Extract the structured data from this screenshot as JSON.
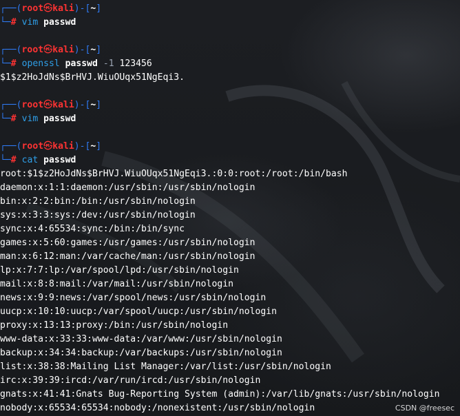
{
  "prompt": {
    "open": "┌──(",
    "user": "root",
    "skull": "㉿",
    "host": "kali",
    "mid": ")-[",
    "dir": "~",
    "close": "]",
    "lower": "└─",
    "hash": "#"
  },
  "commands": [
    {
      "cmd": "vim",
      "args": [
        "passwd"
      ]
    },
    {
      "cmd": "openssl",
      "args": [
        "passwd"
      ],
      "opt": "-1",
      "num": "123456"
    },
    {
      "cmd": "vim",
      "args": [
        "passwd"
      ]
    },
    {
      "cmd": "cat",
      "args": [
        "passwd"
      ]
    }
  ],
  "openssl_output": "$1$z2HoJdNs$BrHVJ.WiuOUqx51NgEqi3.",
  "passwd_lines": [
    "root:$1$z2HoJdNs$BrHVJ.WiuOUqx51NgEqi3.:0:0:root:/root:/bin/bash",
    "daemon:x:1:1:daemon:/usr/sbin:/usr/sbin/nologin",
    "bin:x:2:2:bin:/bin:/usr/sbin/nologin",
    "sys:x:3:3:sys:/dev:/usr/sbin/nologin",
    "sync:x:4:65534:sync:/bin:/bin/sync",
    "games:x:5:60:games:/usr/games:/usr/sbin/nologin",
    "man:x:6:12:man:/var/cache/man:/usr/sbin/nologin",
    "lp:x:7:7:lp:/var/spool/lpd:/usr/sbin/nologin",
    "mail:x:8:8:mail:/var/mail:/usr/sbin/nologin",
    "news:x:9:9:news:/var/spool/news:/usr/sbin/nologin",
    "uucp:x:10:10:uucp:/var/spool/uucp:/usr/sbin/nologin",
    "proxy:x:13:13:proxy:/bin:/usr/sbin/nologin",
    "www-data:x:33:33:www-data:/var/www:/usr/sbin/nologin",
    "backup:x:34:34:backup:/var/backups:/usr/sbin/nologin",
    "list:x:38:38:Mailing List Manager:/var/list:/usr/sbin/nologin",
    "irc:x:39:39:ircd:/var/run/ircd:/usr/sbin/nologin",
    "gnats:x:41:41:Gnats Bug-Reporting System (admin):/var/lib/gnats:/usr/sbin/nologin",
    "nobody:x:65534:65534:nobody:/nonexistent:/usr/sbin/nologin"
  ],
  "watermark": "CSDN @freesec",
  "colors": {
    "prompt_frame": "#2f7bf5",
    "prompt_user_host": "#ff3333",
    "command": "#2f9fe8",
    "option": "#9aa4b2",
    "text": "#ffffff",
    "background": "#1a1c20"
  }
}
